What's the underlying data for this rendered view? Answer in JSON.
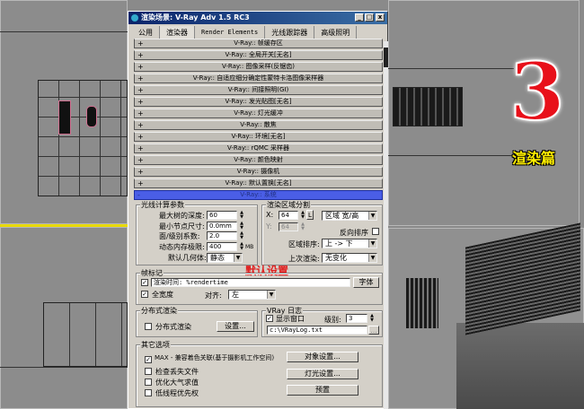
{
  "window": {
    "title": "渲染场景: V-Ray Adv 1.5 RC3",
    "min": "_",
    "max": "□",
    "close": "x"
  },
  "tabs": [
    "公用",
    "渲染器",
    "Render Elements",
    "光线跟踪器",
    "高级照明"
  ],
  "rollouts": [
    "V-Ray:: 帧缓存区",
    "V-Ray:: 全局开关[无名]",
    "V-Ray:: 图像采样(反锯齿)",
    "V-Ray:: 自适应细分确定性蒙特卡洛图像采样器",
    "V-Ray:: 间接照明(GI)",
    "V-Ray:: 发光贴图[无名]",
    "V-Ray:: 灯光缓冲",
    "V-Ray:: 散焦",
    "V-Ray:: 环境[无名]",
    "V-Ray:: rQMC 采样器",
    "V-Ray:: 颜色映射",
    "V-Ray:: 摄像机",
    "V-Ray:: 默认置换[无名]"
  ],
  "rollout_plus": "+",
  "system": {
    "title": "V-Ray:: 系统",
    "collapse": "-",
    "raycast": {
      "title": "光线计算参数",
      "max_depth_label": "最大树的深度:",
      "max_depth": "60",
      "min_leaf_label": "最小节点尺寸:",
      "min_leaf": "0.0mm",
      "face_level_label": "面/级别系数:",
      "face_level": "2.0",
      "mem_limit_label": "动态内存极限:",
      "mem_limit": "400",
      "mem_unit": "MB",
      "geometry_label": "默认几何体:",
      "geometry": "静态"
    },
    "region": {
      "title": "渲染区域分割",
      "x_label": "X:",
      "x": "64",
      "lock": "L",
      "y_label": "Y:",
      "y": "64",
      "mode": "区域 宽/高",
      "reverse_label": "反向排序",
      "order_label": "区域排序:",
      "order": "上 -> 下",
      "previous_label": "上次渲染:",
      "previous": "无变化"
    },
    "default_note": "默认设置",
    "stamp": {
      "title": "帧标记",
      "checked": "✓",
      "text": "渲染时间: %rendertime",
      "font_button": "字体",
      "full_width_label": "全宽度",
      "align_label": "对齐:",
      "align": "左"
    },
    "distributed": {
      "title": "分布式渲染",
      "label": "分布式渲染",
      "settings_button": "设置..."
    },
    "log": {
      "title": "VRay 日志",
      "show_label": "显示窗口",
      "level_label": "级别:",
      "level": "3",
      "path": "c:\\VRayLog.txt",
      "browse": "..."
    },
    "misc": {
      "title": "其它选项",
      "max_compat": "MAX - 兼容着色关联(基于摄影机工作空间)",
      "check_missing": "检查丢失文件",
      "optimize_atm": "优化大气求值",
      "low_priority": "低线程优先权",
      "object_settings": "对象设置...",
      "light_settings": "灯光设置...",
      "presets": "预置"
    }
  },
  "overlay": {
    "number": "3",
    "caption": "渲染篇"
  },
  "colors": {
    "selected": "#4a5ee6",
    "note": "#e02020",
    "logo_red": "#e8101a",
    "logo_yellow": "#ffee00"
  }
}
